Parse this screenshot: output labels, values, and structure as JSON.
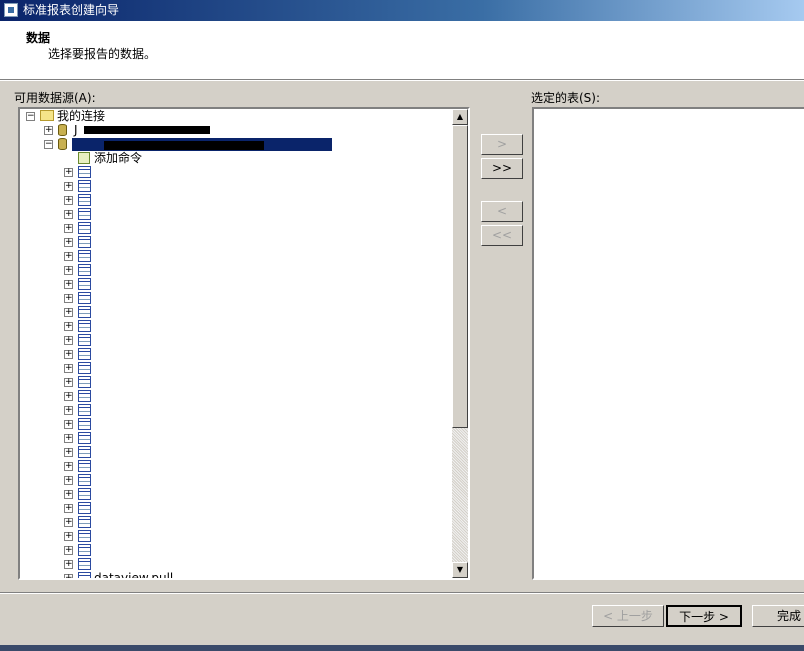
{
  "window": {
    "title": "标准报表创建向导"
  },
  "header": {
    "title": "数据",
    "subtitle": "选择要报告的数据。"
  },
  "available": {
    "label": "可用数据源(A):"
  },
  "selected": {
    "label": "选定的表(S):"
  },
  "tree": {
    "root_label": "我的连接",
    "add_command": "添加命令",
    "conn1_label": "J",
    "last_label": "dataview.pull",
    "table_count": 30
  },
  "transfer": {
    "add": ">",
    "add_all": ">>",
    "remove": "<",
    "remove_all": "<<"
  },
  "footer": {
    "back": "< 上一步",
    "next": "下一步 >",
    "finish": "完成"
  }
}
